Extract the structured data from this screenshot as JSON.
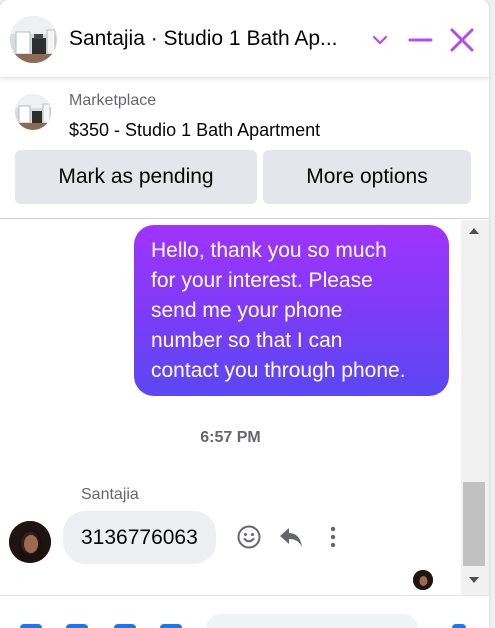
{
  "header": {
    "title": "Santajia · Studio 1 Bath Ap...",
    "icons": [
      "chevron-down-icon",
      "minimize-icon",
      "close-icon"
    ],
    "accent_color": "#b34ce8"
  },
  "listing": {
    "source": "Marketplace",
    "title": "$350 - Studio 1 Bath Apartment",
    "buttons": {
      "pending": "Mark as pending",
      "more": "More options"
    }
  },
  "messages": {
    "outgoing": {
      "lines": [
        "Hello, thank you so much",
        "for your interest. Please",
        "send me your phone",
        "number so that I can",
        "contact you through phone."
      ]
    },
    "timestamp": "6:57 PM",
    "incoming": {
      "sender": "Santajia",
      "text": "3136776063"
    },
    "actions": [
      "emoji-react-icon",
      "reply-icon",
      "more-vertical-icon"
    ]
  },
  "colors": {
    "bubble_gradient_top": "#a033ff",
    "bubble_gradient_bottom": "#5b47f5",
    "incoming_bubble": "#eeeff2",
    "button_bg": "#e4e6eb",
    "composer_icon": "#1877f2"
  }
}
